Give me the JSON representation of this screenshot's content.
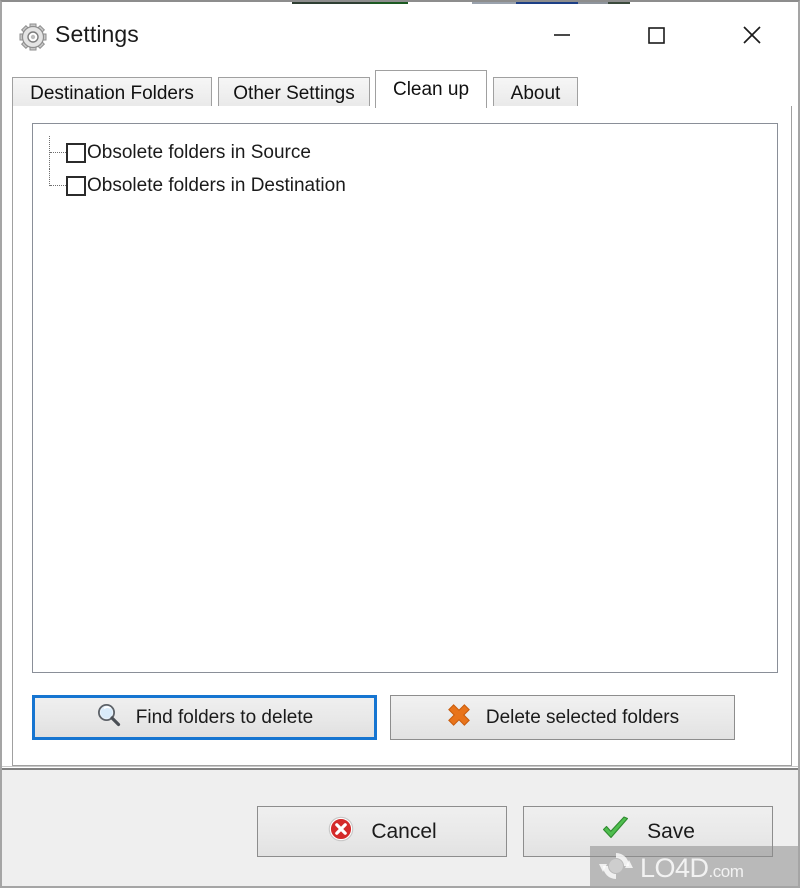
{
  "window": {
    "title": "Settings",
    "icon": "gear-icon",
    "controls": {
      "minimize": "–",
      "maximize": "□",
      "close": "✕"
    }
  },
  "tabs": [
    {
      "label": "Destination Folders",
      "active": false
    },
    {
      "label": "Other Settings",
      "active": false
    },
    {
      "label": "Clean up",
      "active": true
    },
    {
      "label": "About",
      "active": false
    }
  ],
  "cleanup": {
    "tree": {
      "items": [
        {
          "label": "Obsolete folders in Source",
          "checked": false
        },
        {
          "label": "Obsolete folders in Destination",
          "checked": false
        }
      ]
    },
    "actions": [
      {
        "label": "Find folders to delete",
        "icon": "magnifier-icon",
        "focused": true
      },
      {
        "label": "Delete selected folders",
        "icon": "orange-x-icon",
        "focused": false
      }
    ]
  },
  "dialog_buttons": [
    {
      "label": "Cancel",
      "icon": "red-circle-x-icon"
    },
    {
      "label": "Save",
      "icon": "green-check-icon"
    }
  ],
  "watermark": {
    "text": "LO4D",
    "suffix": ".com",
    "icon": "circular-arrows-icon"
  },
  "colors": {
    "focus_blue": "#1675d1",
    "delete_orange": "#e8741b",
    "cancel_red": "#d42a2a",
    "save_green": "#3faa3f",
    "window_bg": "#ffffff",
    "panel_bg": "#efefef"
  }
}
